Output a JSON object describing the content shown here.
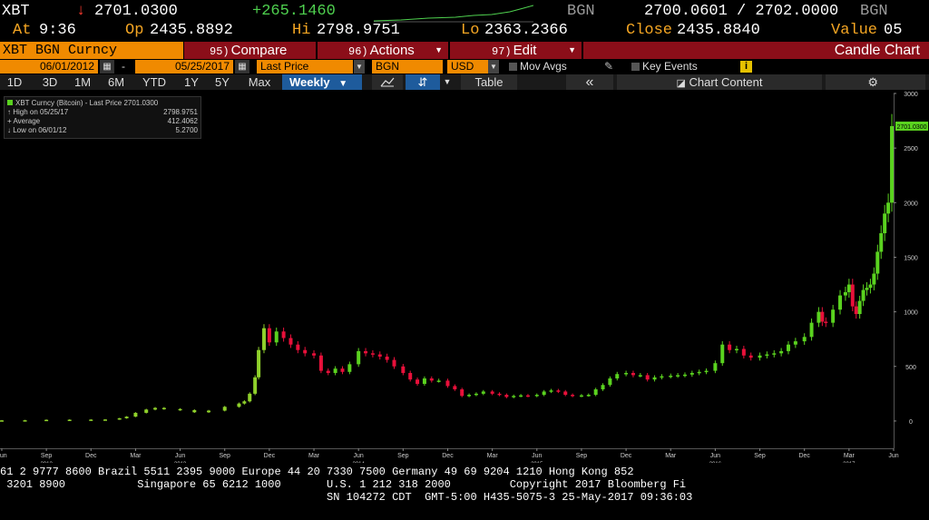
{
  "quote": {
    "ticker": "XBT",
    "arrow": "↓",
    "last": "2701.0300",
    "change": "+265.1460",
    "source1": "BGN",
    "bid_ask": "2700.0601 / 2702.0000",
    "source2": "BGN",
    "at_label": "At",
    "time": "9:36",
    "op_label": "Op",
    "open": "2435.8892",
    "hi_label": "Hi",
    "high": "2798.9751",
    "lo_label": "Lo",
    "low": "2363.2366",
    "close_label": "Close",
    "close": "2435.8840",
    "value_label": "Value",
    "value": "05"
  },
  "header": {
    "title": "XBT BGN Curncy",
    "compare_num": "95)",
    "compare_label": "Compare",
    "actions_num": "96)",
    "actions_label": "Actions",
    "edit_num": "97)",
    "edit_label": "Edit",
    "chart_type": "Candle Chart"
  },
  "params": {
    "start_date": "06/01/2012",
    "dash": "-",
    "end_date": "05/25/2017",
    "field": "Last Price",
    "source": "BGN",
    "currency": "USD",
    "mov_avgs": "Mov Avgs",
    "key_events": "Key Events",
    "info": "i"
  },
  "toolbar": {
    "periods": [
      "1D",
      "3D",
      "1M",
      "6M",
      "YTD",
      "1Y",
      "5Y",
      "Max"
    ],
    "frequency": "Weekly",
    "table": "Table",
    "collapse": "«",
    "chart_content": "Chart Content"
  },
  "legend": {
    "title": "XBT Curncy (Bitcoin) - Last Price 2701.0300",
    "high_label": "High on 05/25/17",
    "high_value": "2798.9751",
    "avg_label": "Average",
    "avg_value": "412.4062",
    "low_label": "Low on 06/01/12",
    "low_value": "5.2700"
  },
  "chart_data": {
    "type": "candlestick",
    "title": "XBT Curncy (Bitcoin) - Last Price",
    "frequency": "Weekly",
    "ylim": [
      -250,
      3000
    ],
    "yticks": [
      0,
      500,
      1000,
      1500,
      2000,
      2500,
      3000
    ],
    "last_price_label": "2701.0300",
    "xticks": [
      {
        "label": "Jun",
        "year": "",
        "x": 2012.42
      },
      {
        "label": "Sep",
        "year": "2012",
        "x": 2012.67
      },
      {
        "label": "Dec",
        "year": "",
        "x": 2012.92
      },
      {
        "label": "Mar",
        "year": "",
        "x": 2013.17
      },
      {
        "label": "Jun",
        "year": "2013",
        "x": 2013.42
      },
      {
        "label": "Sep",
        "year": "",
        "x": 2013.67
      },
      {
        "label": "Dec",
        "year": "",
        "x": 2013.92
      },
      {
        "label": "Mar",
        "year": "",
        "x": 2014.17
      },
      {
        "label": "Jun",
        "year": "2014",
        "x": 2014.42
      },
      {
        "label": "Sep",
        "year": "",
        "x": 2014.67
      },
      {
        "label": "Dec",
        "year": "",
        "x": 2014.92
      },
      {
        "label": "Mar",
        "year": "",
        "x": 2015.17
      },
      {
        "label": "Jun",
        "year": "2015",
        "x": 2015.42
      },
      {
        "label": "Sep",
        "year": "",
        "x": 2015.67
      },
      {
        "label": "Dec",
        "year": "",
        "x": 2015.92
      },
      {
        "label": "Mar",
        "year": "",
        "x": 2016.17
      },
      {
        "label": "Jun",
        "year": "2016",
        "x": 2016.42
      },
      {
        "label": "Sep",
        "year": "",
        "x": 2016.67
      },
      {
        "label": "Dec",
        "year": "",
        "x": 2016.92
      },
      {
        "label": "Mar",
        "year": "2017",
        "x": 2017.17
      },
      {
        "label": "Jun",
        "year": "",
        "x": 2017.42
      }
    ],
    "xlim": [
      2012.41,
      2017.42
    ],
    "series": [
      {
        "name": "XBT Curncy (Bitcoin)",
        "points": [
          [
            2012.42,
            6
          ],
          [
            2012.55,
            7
          ],
          [
            2012.67,
            11
          ],
          [
            2012.8,
            12
          ],
          [
            2012.92,
            13
          ],
          [
            2013.0,
            14
          ],
          [
            2013.08,
            25
          ],
          [
            2013.12,
            40
          ],
          [
            2013.17,
            75
          ],
          [
            2013.23,
            105
          ],
          [
            2013.28,
            120
          ],
          [
            2013.33,
            110
          ],
          [
            2013.42,
            100
          ],
          [
            2013.5,
            80
          ],
          [
            2013.58,
            95
          ],
          [
            2013.67,
            130
          ],
          [
            2013.75,
            160
          ],
          [
            2013.78,
            180
          ],
          [
            2013.81,
            250
          ],
          [
            2013.84,
            400
          ],
          [
            2013.86,
            650
          ],
          [
            2013.89,
            850
          ],
          [
            2013.92,
            720
          ],
          [
            2013.96,
            820
          ],
          [
            2014.0,
            760
          ],
          [
            2014.04,
            700
          ],
          [
            2014.08,
            650
          ],
          [
            2014.12,
            620
          ],
          [
            2014.17,
            600
          ],
          [
            2014.21,
            460
          ],
          [
            2014.25,
            440
          ],
          [
            2014.29,
            480
          ],
          [
            2014.33,
            450
          ],
          [
            2014.37,
            520
          ],
          [
            2014.42,
            640
          ],
          [
            2014.46,
            620
          ],
          [
            2014.5,
            610
          ],
          [
            2014.54,
            590
          ],
          [
            2014.58,
            560
          ],
          [
            2014.62,
            500
          ],
          [
            2014.67,
            440
          ],
          [
            2014.71,
            380
          ],
          [
            2014.75,
            340
          ],
          [
            2014.79,
            390
          ],
          [
            2014.83,
            370
          ],
          [
            2014.87,
            370
          ],
          [
            2014.92,
            320
          ],
          [
            2014.96,
            290
          ],
          [
            2015.0,
            230
          ],
          [
            2015.04,
            240
          ],
          [
            2015.08,
            250
          ],
          [
            2015.12,
            270
          ],
          [
            2015.17,
            250
          ],
          [
            2015.21,
            240
          ],
          [
            2015.25,
            220
          ],
          [
            2015.29,
            230
          ],
          [
            2015.33,
            235
          ],
          [
            2015.37,
            230
          ],
          [
            2015.42,
            240
          ],
          [
            2015.46,
            270
          ],
          [
            2015.5,
            280
          ],
          [
            2015.54,
            270
          ],
          [
            2015.58,
            240
          ],
          [
            2015.62,
            230
          ],
          [
            2015.67,
            235
          ],
          [
            2015.71,
            240
          ],
          [
            2015.75,
            290
          ],
          [
            2015.79,
            330
          ],
          [
            2015.83,
            390
          ],
          [
            2015.87,
            430
          ],
          [
            2015.92,
            440
          ],
          [
            2015.96,
            420
          ],
          [
            2016.0,
            420
          ],
          [
            2016.04,
            380
          ],
          [
            2016.08,
            400
          ],
          [
            2016.12,
            410
          ],
          [
            2016.17,
            415
          ],
          [
            2016.21,
            420
          ],
          [
            2016.25,
            425
          ],
          [
            2016.29,
            440
          ],
          [
            2016.33,
            450
          ],
          [
            2016.37,
            460
          ],
          [
            2016.42,
            530
          ],
          [
            2016.46,
            700
          ],
          [
            2016.5,
            650
          ],
          [
            2016.54,
            660
          ],
          [
            2016.58,
            600
          ],
          [
            2016.62,
            580
          ],
          [
            2016.67,
            600
          ],
          [
            2016.71,
            610
          ],
          [
            2016.75,
            620
          ],
          [
            2016.79,
            640
          ],
          [
            2016.83,
            700
          ],
          [
            2016.87,
            730
          ],
          [
            2016.92,
            770
          ],
          [
            2016.96,
            900
          ],
          [
            2017.0,
            1000
          ],
          [
            2017.02,
            910
          ],
          [
            2017.04,
            900
          ],
          [
            2017.08,
            1020
          ],
          [
            2017.12,
            1150
          ],
          [
            2017.15,
            1180
          ],
          [
            2017.17,
            1250
          ],
          [
            2017.19,
            1050
          ],
          [
            2017.21,
            980
          ],
          [
            2017.23,
            1100
          ],
          [
            2017.25,
            1200
          ],
          [
            2017.27,
            1220
          ],
          [
            2017.29,
            1250
          ],
          [
            2017.31,
            1350
          ],
          [
            2017.33,
            1550
          ],
          [
            2017.35,
            1720
          ],
          [
            2017.37,
            1900
          ],
          [
            2017.39,
            2000
          ],
          [
            2017.41,
            2701
          ]
        ]
      }
    ]
  },
  "footer": {
    "line1": "61 2 9777 8600 Brazil 5511 2395 9000 Europe 44 20 7330 7500 Germany 49 69 9204 1210 Hong Kong 852",
    "line2": " 3201 8900           Singapore 65 6212 1000       U.S. 1 212 318 2000         Copyright 2017 Bloomberg Fi",
    "line3": "                                                  SN 104272 CDT  GMT-5:00 H435-5075-3 25-May-2017 09:36:03",
    "colors": {
      "up": "#5ad21f",
      "down": "#e8103a",
      "pre": "#8fd12b"
    }
  }
}
